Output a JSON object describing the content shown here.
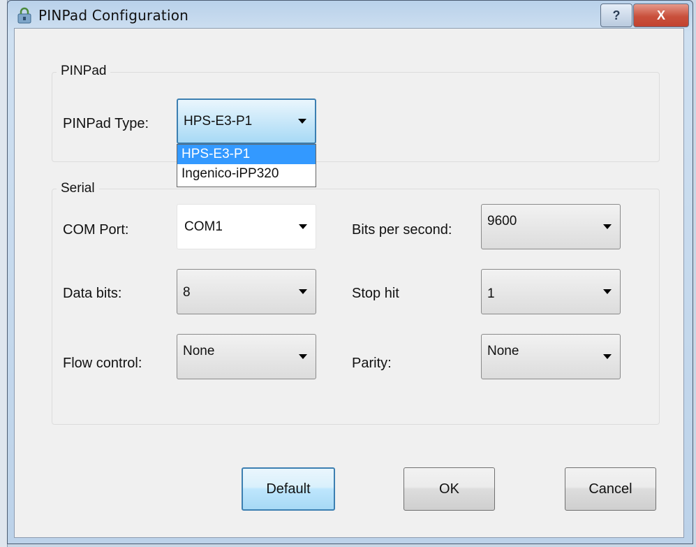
{
  "window": {
    "title": "PINPad Configuration",
    "help_label": "?",
    "close_label": "X"
  },
  "pinpad_group": {
    "title": "PINPad",
    "type_label": "PINPad Type:",
    "type_value": "HPS-E3-P1",
    "type_options": [
      "HPS-E3-P1",
      "Ingenico-iPP320"
    ]
  },
  "serial_group": {
    "title": "Serial",
    "com_port": {
      "label": "COM Port:",
      "value": "COM1"
    },
    "bits_per_second": {
      "label": "Bits per second:",
      "value": "9600"
    },
    "data_bits": {
      "label": "Data bits:",
      "value": "8"
    },
    "stop_bit": {
      "label": "Stop hit",
      "value": "1"
    },
    "flow_control": {
      "label": "Flow control:",
      "value": "None"
    },
    "parity": {
      "label": "Parity:",
      "value": "None"
    }
  },
  "buttons": {
    "default": "Default",
    "ok": "OK",
    "cancel": "Cancel"
  },
  "colors": {
    "selection": "#3399ff",
    "focus_border": "#3c7fb1",
    "close_red": "#c9503c"
  },
  "icons": {
    "title": "lock-icon",
    "help": "help-icon",
    "close": "close-icon",
    "dropdown": "chevron-down-icon"
  }
}
